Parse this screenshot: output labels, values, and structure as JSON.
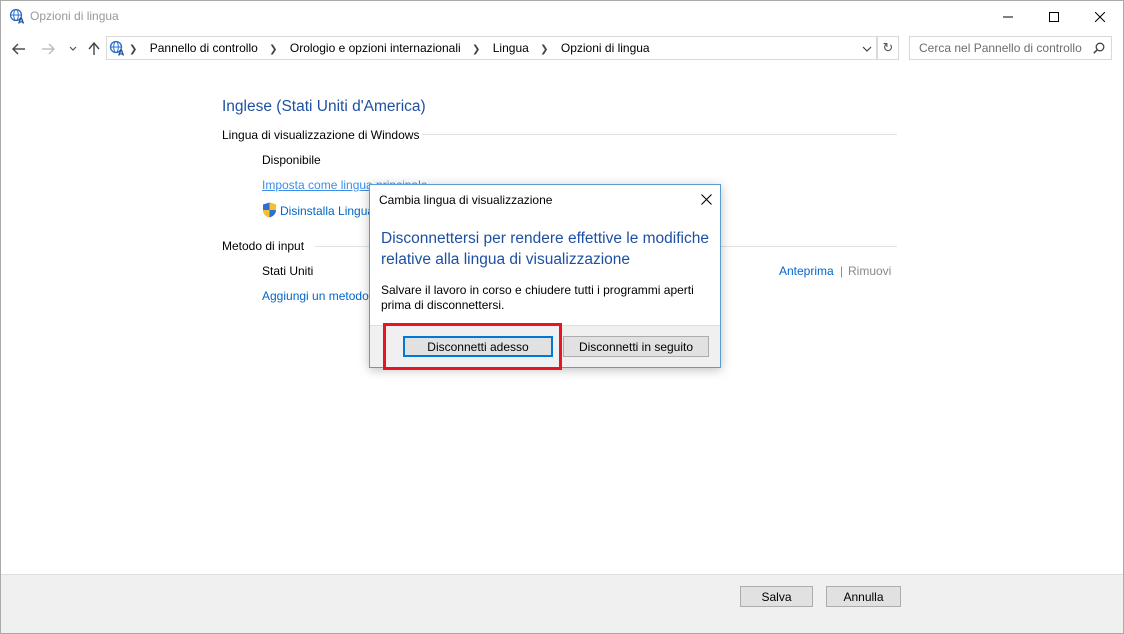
{
  "window": {
    "title": "Opzioni di lingua"
  },
  "nav": {
    "breadcrumbs": [
      "Pannello di controllo",
      "Orologio e opzioni internazionali",
      "Lingua",
      "Opzioni di lingua"
    ],
    "search_placeholder": "Cerca nel Pannello di controllo"
  },
  "content": {
    "language_name": "Inglese (Stati Uniti d'America)",
    "display_section_label": "Lingua di visualizzazione di Windows",
    "display_status": "Disponibile",
    "set_primary_link": "Imposta come lingua principale",
    "uninstall_link": "Disinstalla Lingua",
    "input_section_label": "Metodo di input",
    "input_method_name": "Stati Uniti",
    "preview_link": "Anteprima",
    "link_separator": "|",
    "remove_link": "Rimuovi",
    "add_input_link": "Aggiungi un metodo di input"
  },
  "footer": {
    "save_label": "Salva",
    "cancel_label": "Annulla"
  },
  "dialog": {
    "title": "Cambia lingua di visualizzazione",
    "main_instruction": "Disconnettersi per rendere effettive le modifiche relative alla lingua di visualizzazione",
    "body_text": "Salvare il lavoro in corso e chiudere tutti i programmi aperti prima di disconnettersi.",
    "signout_now_label": "Disconnetti adesso",
    "signout_later_label": "Disconnetti in seguito"
  },
  "colors": {
    "heading_blue": "#1e50a2",
    "link_blue": "#0066cc",
    "highlight_red": "#e8141f",
    "dialog_border": "#5b9bd5"
  },
  "icons": {
    "app": "globe-language-icon",
    "shield": "uac-shield-icon"
  }
}
